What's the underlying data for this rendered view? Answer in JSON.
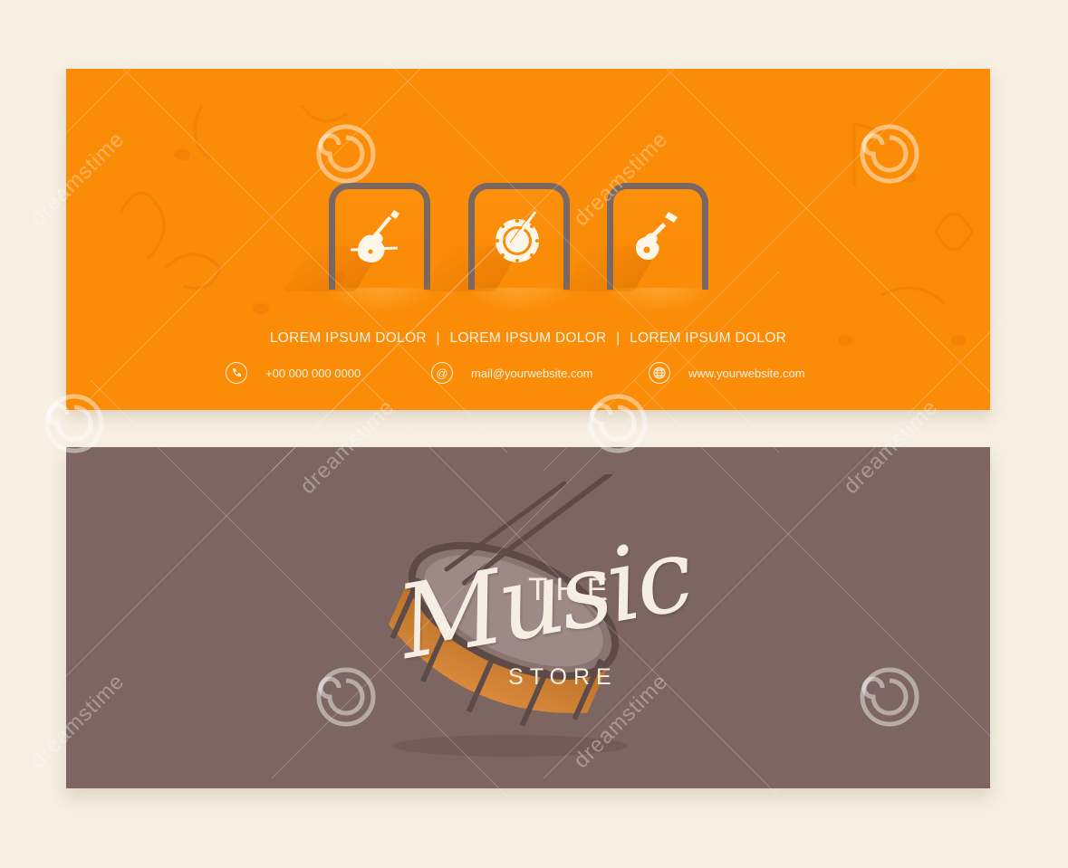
{
  "orange_banner": {
    "menu": [
      "LOREM IPSUM DOLOR",
      "LOREM IPSUM DOLOR",
      "LOREM IPSUM DOLOR"
    ],
    "menu_separator": "|",
    "phone": "+00 000 000 0000",
    "email": "mail@yourwebsite.com",
    "website": "www.yourwebsite.com",
    "tile_icons": [
      "violin-icon",
      "drum-icon",
      "guitar-icon"
    ],
    "colors": {
      "background": "#fb8c08",
      "frame": "#7b6761",
      "text": "#fff3e2"
    }
  },
  "brown_banner": {
    "logo": {
      "the": "THE",
      "music": "Music",
      "store": "STORE"
    },
    "colors": {
      "background": "#7d6662",
      "logo_text": "#f6eee2"
    }
  },
  "watermark": {
    "text": "dreamstime"
  },
  "page": {
    "background": "#f6efe2"
  }
}
